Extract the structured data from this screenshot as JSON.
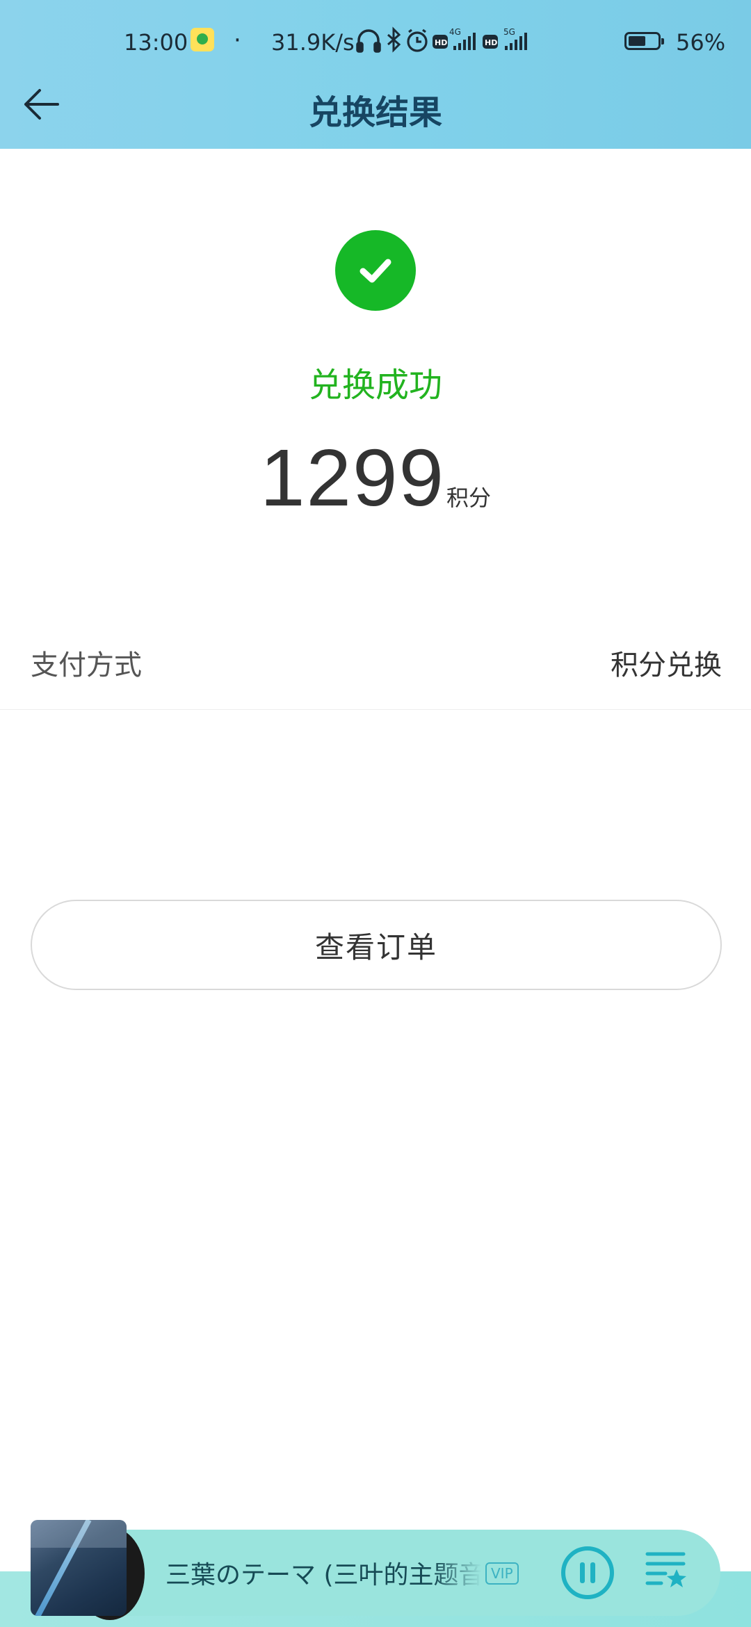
{
  "status_bar": {
    "time": "13:00",
    "dot": "·",
    "net_speed": "31.9K/s",
    "battery": "56%",
    "icons": [
      "app-icon",
      "headphones-icon",
      "bluetooth-icon",
      "alarm-icon",
      "hd-icon",
      "4g-signal-icon",
      "hd-icon",
      "5g-signal-icon",
      "battery-icon"
    ]
  },
  "header": {
    "title": "兑换结果",
    "back_icon": "arrow-left-icon"
  },
  "result": {
    "icon": "check-circle-icon",
    "status_text": "兑换成功",
    "points": "1299",
    "points_unit": "积分"
  },
  "payment": {
    "label": "支付方式",
    "value": "积分兑换"
  },
  "actions": {
    "view_order_label": "查看订单"
  },
  "player": {
    "song_title": "三葉のテーマ (三叶的主题音乐)",
    "vip_label": "VIP",
    "pause_icon": "pause-icon",
    "playlist_icon": "playlist-star-icon"
  },
  "colors": {
    "header_bg": "#82cfe9",
    "success_green": "#16b827",
    "title_dark_blue": "#174562",
    "player_bg": "#9ae4dd",
    "player_accent": "#1fb2c3"
  }
}
